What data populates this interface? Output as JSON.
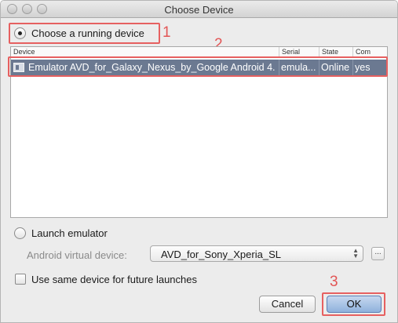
{
  "window": {
    "title": "Choose Device"
  },
  "running": {
    "label": "Choose a running device",
    "selected": true
  },
  "table": {
    "columns": [
      "Device",
      "Serial",
      "State",
      "Com"
    ],
    "rows": [
      {
        "device": "Emulator AVD_for_Galaxy_Nexus_by_Google Android 4.",
        "serial": "emula...",
        "state": "Online",
        "compatible": "yes"
      }
    ]
  },
  "launch": {
    "label": "Launch emulator",
    "selected": false
  },
  "avd": {
    "label": "Android virtual device:",
    "value": "AVD_for_Sony_Xperia_SL",
    "more_label": "..."
  },
  "same_device": {
    "label": "Use same device for future launches",
    "checked": false
  },
  "buttons": {
    "cancel": "Cancel",
    "ok": "OK"
  },
  "annotations": {
    "marker1": "1",
    "marker2": "2",
    "marker3": "3",
    "color": "#e25555"
  },
  "colors": {
    "selection": "#6b7991",
    "default_button": "#8fb1dc"
  }
}
